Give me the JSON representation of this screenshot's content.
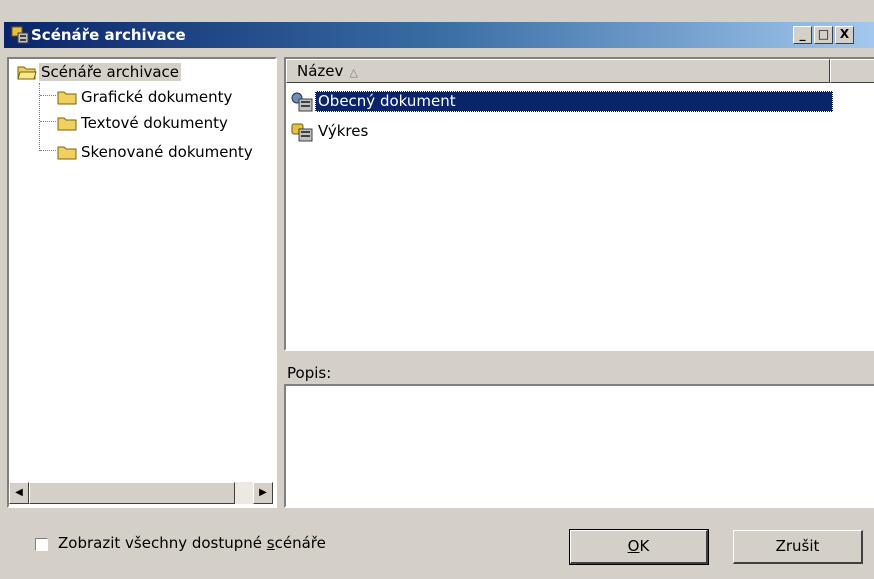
{
  "window": {
    "title": "Scénáře archivace",
    "title_icon": "scenario-icon",
    "controls": [
      "minimize",
      "maximize",
      "close"
    ],
    "control_glyphs": {
      "minimize": "_",
      "maximize": "□",
      "close": "X"
    }
  },
  "tree": {
    "root": {
      "label": "Scénáře archivace",
      "icon": "open-folder-icon",
      "selected": true
    },
    "children": [
      {
        "label": "Grafické dokumenty",
        "icon": "folder-icon"
      },
      {
        "label": "Textové dokumenty",
        "icon": "folder-icon"
      },
      {
        "label": "Skenované dokumenty",
        "icon": "folder-icon"
      }
    ],
    "scroll_left_glyph": "◀",
    "scroll_right_glyph": "▶"
  },
  "list": {
    "column_header": "Název",
    "sort_glyph": "△",
    "items": [
      {
        "label": "Obecný dokument",
        "icon": "document-scenario-icon",
        "selected": true
      },
      {
        "label": "Výkres",
        "icon": "drawing-scenario-icon",
        "selected": false
      }
    ]
  },
  "description": {
    "label": "Popis:",
    "value": ""
  },
  "footer": {
    "checkbox_label_pre": "Zobrazit všechny dostupné ",
    "checkbox_label_accel": "s",
    "checkbox_label_post": "cénáře",
    "checkbox_checked": false,
    "ok_accel": "O",
    "ok_rest": "K",
    "cancel_label": "Zrušit"
  },
  "colors": {
    "selection": "#0a246a",
    "face": "#d4d0c8",
    "titlebar_start": "#0a246a",
    "titlebar_end": "#a6caf0"
  }
}
